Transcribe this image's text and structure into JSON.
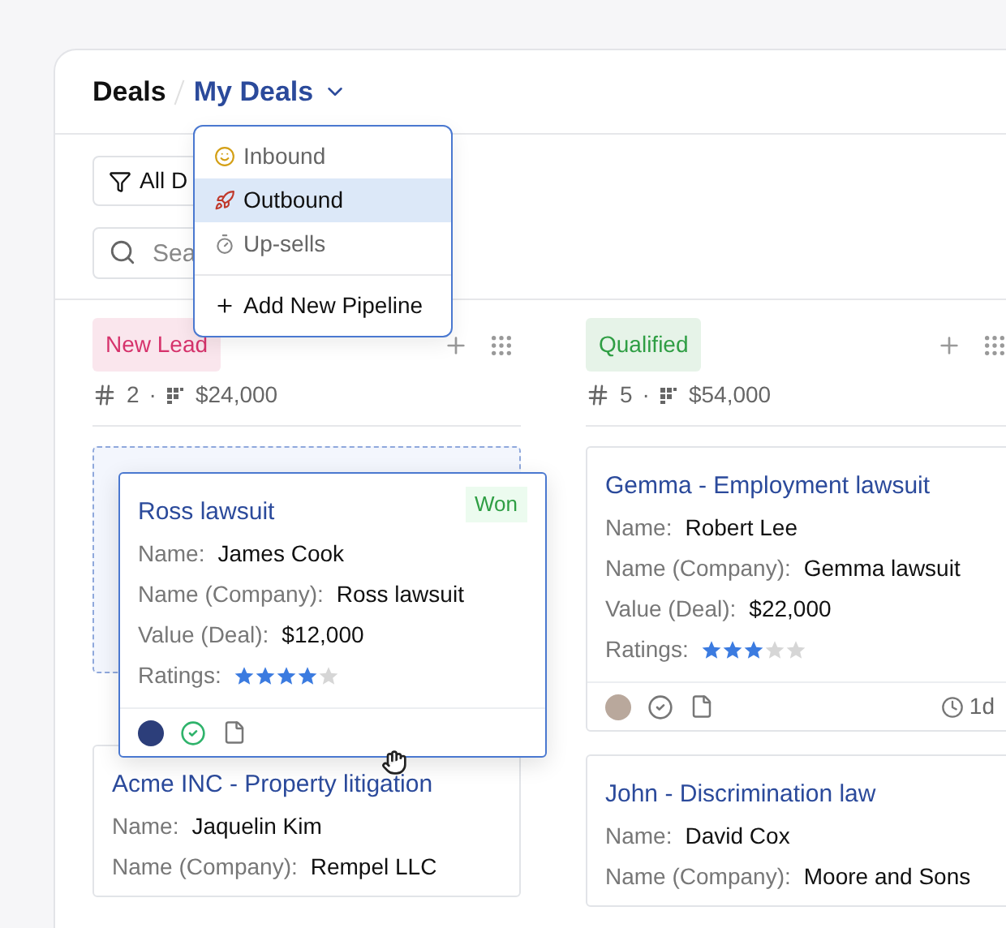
{
  "header": {
    "title": "Deals",
    "pipeline": "My Deals"
  },
  "pipeline_menu": {
    "items": [
      {
        "label": "Inbound",
        "selected": false
      },
      {
        "label": "Outbound",
        "selected": true
      },
      {
        "label": "Up-sells",
        "selected": false
      }
    ],
    "add_label": "Add New Pipeline"
  },
  "filter": {
    "label": "All D"
  },
  "search": {
    "placeholder": "Sea"
  },
  "columns": [
    {
      "title": "New Lead",
      "color": "#d6336c",
      "count": "2",
      "separator": "·",
      "total": "$24,000",
      "cards": [
        {
          "title": "Ross lawsuit",
          "dragging": true,
          "status": "Won",
          "fields": [
            {
              "label": "Name:",
              "value": "James Cook"
            },
            {
              "label": "Name (Company):",
              "value": "Ross lawsuit"
            },
            {
              "label": "Value (Deal):",
              "value": "$12,000"
            }
          ],
          "ratings_label": "Ratings:",
          "stars": 4,
          "task_done": true
        },
        {
          "title": "Acme INC - Property litigation",
          "dragging": false,
          "fields": [
            {
              "label": "Name:",
              "value": "Jaquelin Kim"
            },
            {
              "label": "Name (Company):",
              "value": "Rempel LLC"
            }
          ]
        }
      ]
    },
    {
      "title": "Qualified",
      "color": "#2f9e44",
      "count": "5",
      "separator": "·",
      "total": "$54,000",
      "cards": [
        {
          "title": "Gemma - Employment lawsuit",
          "dragging": false,
          "fields": [
            {
              "label": "Name:",
              "value": "Robert Lee"
            },
            {
              "label": "Name (Company):",
              "value": "Gemma lawsuit"
            },
            {
              "label": "Value (Deal):",
              "value": "$22,000"
            }
          ],
          "ratings_label": "Ratings:",
          "stars": 3,
          "task_done": false,
          "age": "1d"
        },
        {
          "title": "John - Discrimination law",
          "dragging": false,
          "fields": [
            {
              "label": "Name:",
              "value": "David Cox"
            },
            {
              "label": "Name (Company):",
              "value": "Moore and Sons"
            }
          ]
        }
      ]
    }
  ]
}
